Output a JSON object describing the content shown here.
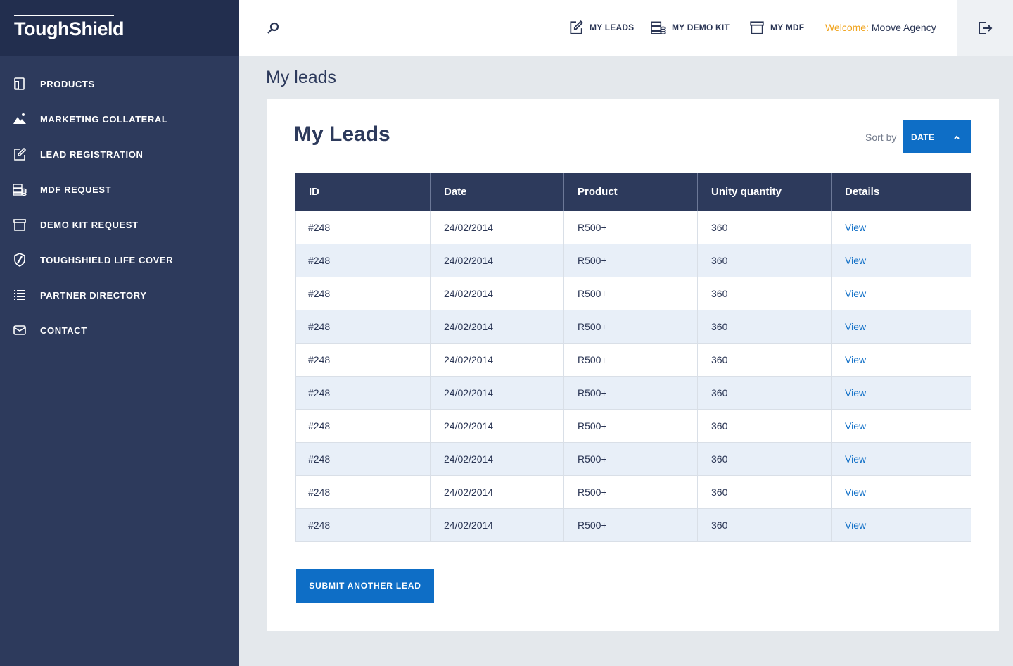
{
  "brand": {
    "name": "ToughShield"
  },
  "sidebar": {
    "items": [
      {
        "label": "PRODUCTS",
        "icon": "products-icon"
      },
      {
        "label": "MARKETING COLLATERAL",
        "icon": "image-icon"
      },
      {
        "label": "LEAD REGISTRATION",
        "icon": "edit-icon"
      },
      {
        "label": "MDF REQUEST",
        "icon": "money-icon"
      },
      {
        "label": "DEMO KIT REQUEST",
        "icon": "box-icon"
      },
      {
        "label": "TOUGHSHIELD LIFE COVER",
        "icon": "shield-icon"
      },
      {
        "label": "PARTNER DIRECTORY",
        "icon": "list-icon"
      },
      {
        "label": "CONTACT",
        "icon": "mail-icon"
      }
    ]
  },
  "topbar": {
    "links": [
      {
        "label": "MY LEADS",
        "icon": "edit-icon"
      },
      {
        "label": "MY DEMO KIT",
        "icon": "money-icon"
      },
      {
        "label": "MY MDF",
        "icon": "box-icon"
      }
    ],
    "welcome_label": "Welcome:",
    "welcome_name": "Moove Agency"
  },
  "page": {
    "heading": "My leads"
  },
  "card": {
    "title": "My Leads",
    "sort_label": "Sort by",
    "sort_value": "DATE",
    "submit_label": "SUBMIT ANOTHER LEAD"
  },
  "table": {
    "headers": [
      "ID",
      "Date",
      "Product",
      "Unity quantity",
      "Details"
    ],
    "rows": [
      {
        "id": "#248",
        "date": "24/02/2014",
        "product": "R500+",
        "quantity": "360",
        "details": "View"
      },
      {
        "id": "#248",
        "date": "24/02/2014",
        "product": "R500+",
        "quantity": "360",
        "details": "View"
      },
      {
        "id": "#248",
        "date": "24/02/2014",
        "product": "R500+",
        "quantity": "360",
        "details": "View"
      },
      {
        "id": "#248",
        "date": "24/02/2014",
        "product": "R500+",
        "quantity": "360",
        "details": "View"
      },
      {
        "id": "#248",
        "date": "24/02/2014",
        "product": "R500+",
        "quantity": "360",
        "details": "View"
      },
      {
        "id": "#248",
        "date": "24/02/2014",
        "product": "R500+",
        "quantity": "360",
        "details": "View"
      },
      {
        "id": "#248",
        "date": "24/02/2014",
        "product": "R500+",
        "quantity": "360",
        "details": "View"
      },
      {
        "id": "#248",
        "date": "24/02/2014",
        "product": "R500+",
        "quantity": "360",
        "details": "View"
      },
      {
        "id": "#248",
        "date": "24/02/2014",
        "product": "R500+",
        "quantity": "360",
        "details": "View"
      },
      {
        "id": "#248",
        "date": "24/02/2014",
        "product": "R500+",
        "quantity": "360",
        "details": "View"
      }
    ]
  },
  "colors": {
    "sidebar": "#2d3a5c",
    "logo_bar": "#222e4e",
    "accent_blue": "#0e6ec6",
    "welcome_orange": "#f0a31c",
    "row_alt": "#e8eff8"
  }
}
